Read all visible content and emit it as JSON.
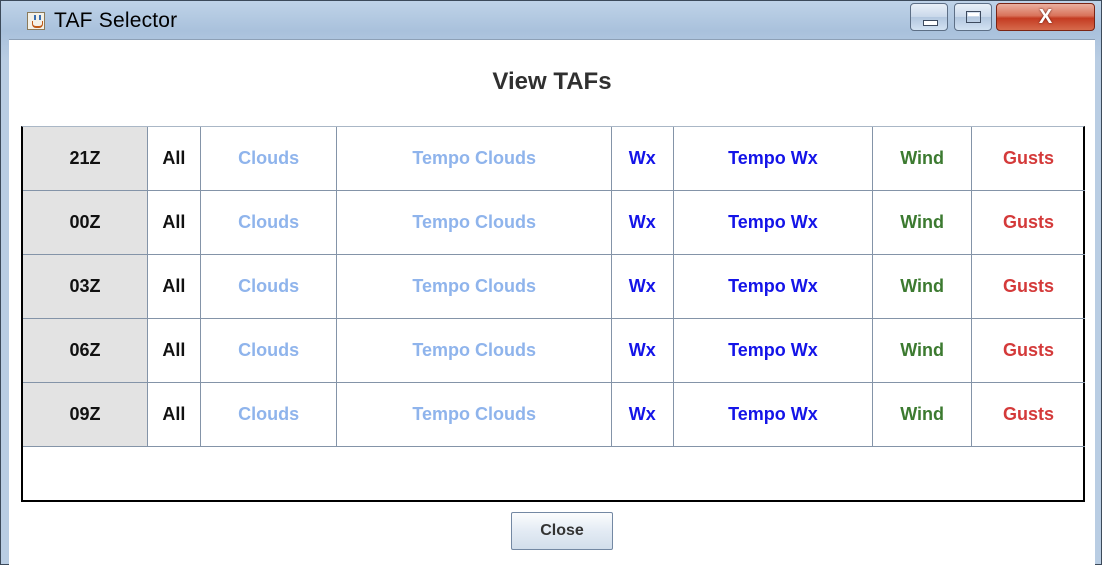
{
  "window": {
    "title": "TAF Selector",
    "close_glyph": "X"
  },
  "heading": "View TAFs",
  "colors": {
    "all": "#111111",
    "clouds": "#8fb4ec",
    "tempo_clouds": "#8fb4ec",
    "wx": "#1414e8",
    "tempo_wx": "#1414e8",
    "wind": "#3c7a30",
    "gusts": "#d43a3a"
  },
  "columns": [
    "All",
    "Clouds",
    "Tempo Clouds",
    "Wx",
    "Tempo Wx",
    "Wind",
    "Gusts"
  ],
  "rows": [
    {
      "time": "21Z",
      "cells": [
        "All",
        "Clouds",
        "Tempo Clouds",
        "Wx",
        "Tempo Wx",
        "Wind",
        "Gusts"
      ]
    },
    {
      "time": "00Z",
      "cells": [
        "All",
        "Clouds",
        "Tempo Clouds",
        "Wx",
        "Tempo Wx",
        "Wind",
        "Gusts"
      ]
    },
    {
      "time": "03Z",
      "cells": [
        "All",
        "Clouds",
        "Tempo Clouds",
        "Wx",
        "Tempo Wx",
        "Wind",
        "Gusts"
      ]
    },
    {
      "time": "06Z",
      "cells": [
        "All",
        "Clouds",
        "Tempo Clouds",
        "Wx",
        "Tempo Wx",
        "Wind",
        "Gusts"
      ]
    },
    {
      "time": "09Z",
      "cells": [
        "All",
        "Clouds",
        "Tempo Clouds",
        "Wx",
        "Tempo Wx",
        "Wind",
        "Gusts"
      ]
    }
  ],
  "footer": {
    "close_label": "Close"
  }
}
